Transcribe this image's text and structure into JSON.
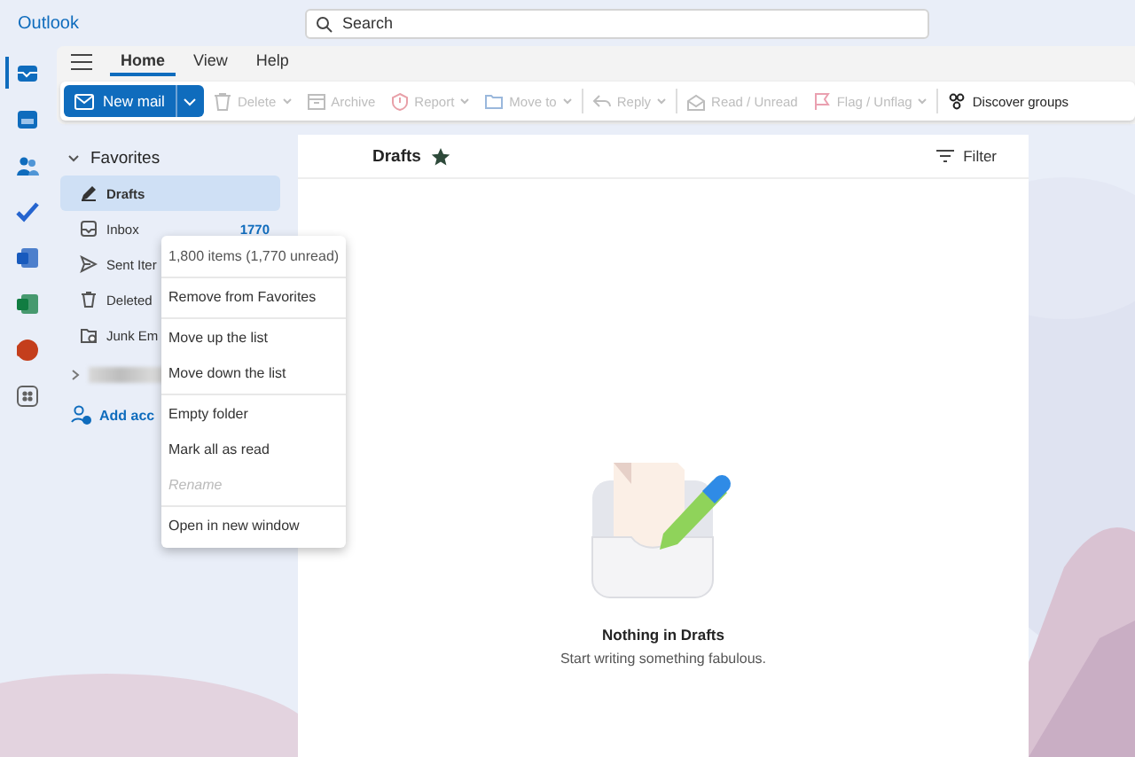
{
  "app_title": "Outlook",
  "search": {
    "placeholder": "Search"
  },
  "rail": [
    {
      "kind": "mail",
      "selected": true
    },
    {
      "kind": "calendar",
      "selected": false
    },
    {
      "kind": "people",
      "selected": false
    },
    {
      "kind": "todo",
      "selected": false
    },
    {
      "kind": "word",
      "selected": false
    },
    {
      "kind": "excel",
      "selected": false
    },
    {
      "kind": "powerpoint",
      "selected": false
    },
    {
      "kind": "apps",
      "selected": false
    }
  ],
  "ribbon_tabs": [
    {
      "label": "Home",
      "selected": true
    },
    {
      "label": "View",
      "selected": false
    },
    {
      "label": "Help",
      "selected": false
    }
  ],
  "new_mail": "New mail",
  "toolbar": [
    {
      "kind": "delete",
      "label": "Delete",
      "disabled": true,
      "dropdown": true
    },
    {
      "kind": "archive",
      "label": "Archive",
      "disabled": true,
      "dropdown": false
    },
    {
      "kind": "report",
      "label": "Report",
      "disabled": true,
      "dropdown": true
    },
    {
      "kind": "move",
      "label": "Move to",
      "disabled": true,
      "dropdown": true
    },
    {
      "kind": "reply",
      "label": "Reply",
      "disabled": true,
      "dropdown": true
    },
    {
      "kind": "read",
      "label": "Read / Unread",
      "disabled": true,
      "dropdown": false
    },
    {
      "kind": "flag",
      "label": "Flag / Unflag",
      "disabled": true,
      "dropdown": true
    },
    {
      "kind": "groups",
      "label": "Discover groups",
      "disabled": false,
      "dropdown": false
    }
  ],
  "favorites": {
    "label": "Favorites",
    "expanded": true,
    "items": [
      {
        "kind": "drafts",
        "label": "Drafts",
        "selected": true
      },
      {
        "kind": "inbox",
        "label": "Inbox",
        "count": "1770",
        "selected": false
      },
      {
        "kind": "sent",
        "label": "Sent Iter",
        "selected": false
      },
      {
        "kind": "deleted",
        "label": "Deleted",
        "selected": false
      },
      {
        "kind": "junk",
        "label": "Junk Em",
        "selected": false
      }
    ]
  },
  "add_account": "Add acc",
  "context_menu": [
    {
      "kind": "info",
      "label": "1,800 items (1,770 unread)"
    },
    {
      "kind": "divider"
    },
    {
      "kind": "item",
      "label": "Remove from Favorites",
      "disabled": false
    },
    {
      "kind": "divider"
    },
    {
      "kind": "item",
      "label": "Move up the list",
      "disabled": false
    },
    {
      "kind": "item",
      "label": "Move down the list",
      "disabled": false
    },
    {
      "kind": "divider"
    },
    {
      "kind": "item",
      "label": "Empty folder",
      "disabled": false
    },
    {
      "kind": "item",
      "label": "Mark all as read",
      "disabled": false
    },
    {
      "kind": "item",
      "label": "Rename",
      "disabled": true
    },
    {
      "kind": "divider"
    },
    {
      "kind": "item",
      "label": "Open in new window",
      "disabled": false
    }
  ],
  "folder": {
    "title": "Drafts",
    "favorite": true,
    "filter": "Filter"
  },
  "empty_state": {
    "title": "Nothing in Drafts",
    "subtitle": "Start writing something fabulous."
  }
}
